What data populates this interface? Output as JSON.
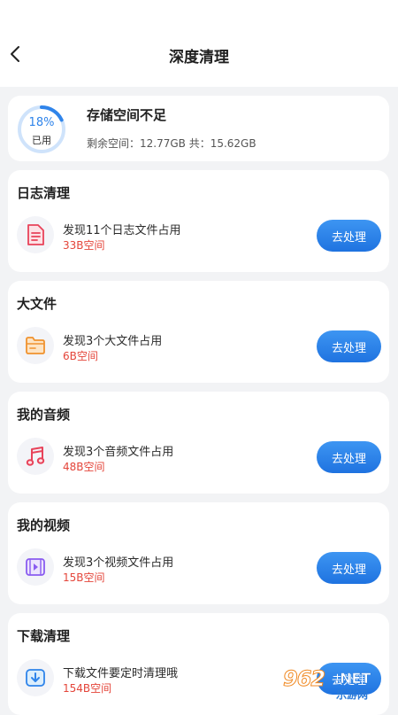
{
  "header": {
    "title": "深度清理"
  },
  "storage": {
    "percent_label": "18%",
    "percent": 18,
    "used_label": "已用",
    "title": "存储空间不足",
    "detail": "剩余空间：12.77GB 共：15.62GB"
  },
  "sections": [
    {
      "title": "日志清理",
      "text": "发现11个日志文件占用",
      "size": "33B空间",
      "button": "去处理",
      "icon": "log-file-icon"
    },
    {
      "title": "大文件",
      "text": "发现3个大文件占用",
      "size": "6B空间",
      "button": "去处理",
      "icon": "folder-icon"
    },
    {
      "title": "我的音频",
      "text": "发现3个音频文件占用",
      "size": "48B空间",
      "button": "去处理",
      "icon": "music-note-icon"
    },
    {
      "title": "我的视频",
      "text": "发现3个视频文件占用",
      "size": "15B空间",
      "button": "去处理",
      "icon": "video-icon"
    },
    {
      "title": "下载清理",
      "text": "下载文件要定时清理哦",
      "size": "154B空间",
      "button": "去处理",
      "icon": "download-icon"
    }
  ],
  "colors": {
    "accent": "#2f84ea",
    "warning_text": "#e4453a",
    "background": "#f2f3f5"
  },
  "watermark": {
    "number": "962",
    "suffix": ".NET",
    "name": "乐游网"
  }
}
